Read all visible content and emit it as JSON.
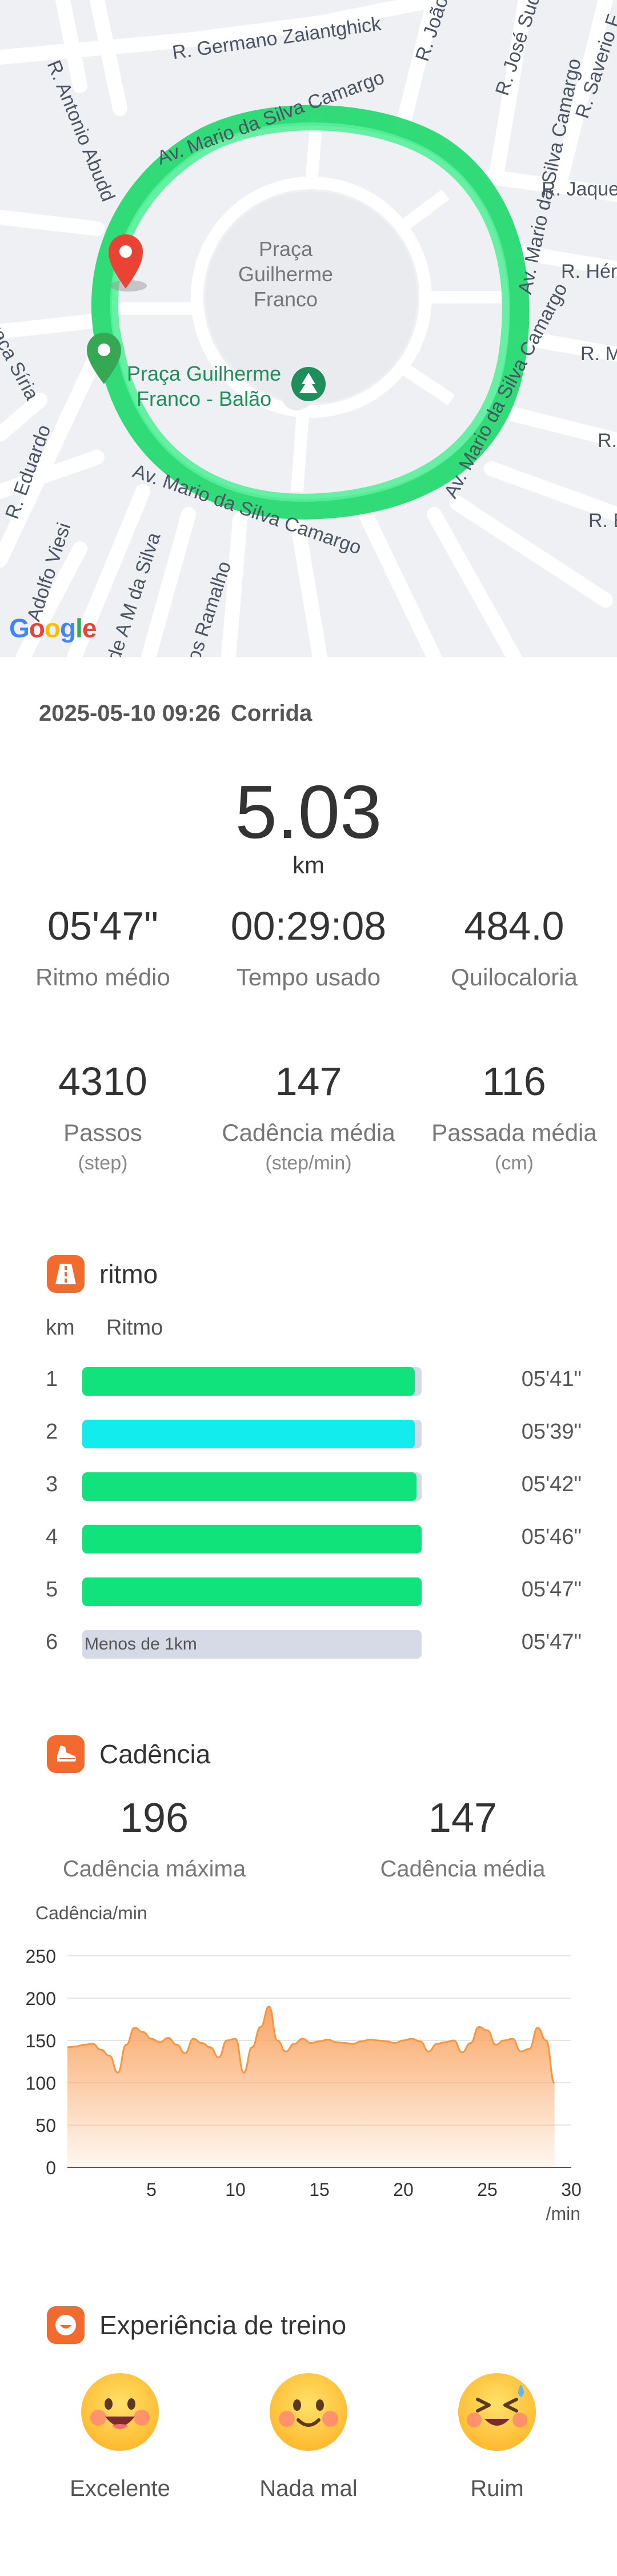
{
  "map": {
    "streets": [
      "R. Germano Zaiantghick",
      "R. Antonio Abudd",
      "R. João S",
      "R. José Sud",
      "R. Saverio F",
      "Av. Mario da Silva Camargo",
      "R. Jaque",
      "R. Hér",
      "R. M",
      "R. ",
      "R. E",
      "Praça Síria",
      "R. Eduardo",
      "Adolfo Viesi",
      "de A M da Silva",
      "os Ramalho",
      "Av. Mario da Silva Camargo",
      "Av. Mario da Silva Camargo",
      "Av. Mario da Silva Camargo"
    ],
    "park_label": "Praça Guilherme Franco",
    "park_label_lines": [
      "Praça",
      "Guilherme",
      "Franco"
    ],
    "poi_label_lines": [
      "Praça Guilherme",
      "Franco - Balão"
    ],
    "google": [
      "G",
      "o",
      "o",
      "g",
      "l",
      "e"
    ]
  },
  "header": {
    "datetime": "2025-05-10 09:26",
    "activity": "Corrida"
  },
  "summary": {
    "distance": "5.03",
    "distance_unit": "km",
    "stats": [
      {
        "value": "05'47\"",
        "label": "Ritmo médio",
        "unit": ""
      },
      {
        "value": "00:29:08",
        "label": "Tempo usado",
        "unit": ""
      },
      {
        "value": "484.0",
        "label": "Quilocaloria",
        "unit": ""
      }
    ],
    "stats2": [
      {
        "value": "4310",
        "label": "Passos",
        "unit": "(step)"
      },
      {
        "value": "147",
        "label": "Cadência média",
        "unit": "(step/min)"
      },
      {
        "value": "116",
        "label": "Passada média",
        "unit": "(cm)"
      }
    ]
  },
  "pace": {
    "title": "ritmo",
    "col_km": "km",
    "col_pace": "Ritmo",
    "rows": [
      {
        "km": "1",
        "time": "05'41\"",
        "fraction": 0.98,
        "color": "#10e37b",
        "note": ""
      },
      {
        "km": "2",
        "time": "05'39\"",
        "fraction": 0.98,
        "color": "#13ecec",
        "note": ""
      },
      {
        "km": "3",
        "time": "05'42\"",
        "fraction": 0.985,
        "color": "#10e37b",
        "note": ""
      },
      {
        "km": "4",
        "time": "05'46\"",
        "fraction": 1.0,
        "color": "#10e37b",
        "note": ""
      },
      {
        "km": "5",
        "time": "05'47\"",
        "fraction": 1.0,
        "color": "#10e37b",
        "note": ""
      },
      {
        "km": "6",
        "time": "05'47\"",
        "fraction": 0.0,
        "color": "#d6d9e6",
        "note": "Menos de 1km"
      }
    ]
  },
  "cadence": {
    "title": "Cadência",
    "max_value": "196",
    "max_label": "Cadência máxima",
    "avg_value": "147",
    "avg_label": "Cadência média"
  },
  "chart_data": {
    "type": "area",
    "ylabel": "Cadência/min",
    "xlabel": "/min",
    "ylim": [
      0,
      250
    ],
    "xlim": [
      0,
      30
    ],
    "yticks": [
      "0",
      "50",
      "100",
      "150",
      "200",
      "250"
    ],
    "xticks": [
      "5",
      "10",
      "15",
      "20",
      "25",
      "30"
    ],
    "grid": true,
    "color": "#f9a15c",
    "x": [
      0,
      0.5,
      1,
      1.5,
      2,
      2.5,
      3,
      3.5,
      4,
      4.5,
      5,
      5.5,
      6,
      6.5,
      7,
      7.5,
      8,
      8.5,
      9,
      9.5,
      10,
      10.5,
      11,
      11.5,
      12,
      12.5,
      13,
      13.5,
      14,
      14.5,
      15,
      15.5,
      16,
      16.5,
      17,
      17.5,
      18,
      18.5,
      19,
      19.5,
      20,
      20.5,
      21,
      21.5,
      22,
      22.5,
      23,
      23.5,
      24,
      24.5,
      25,
      25.5,
      26,
      26.5,
      27,
      27.5,
      28,
      28.5,
      29
    ],
    "values": [
      142,
      143,
      145,
      146,
      139,
      132,
      112,
      145,
      165,
      160,
      152,
      148,
      153,
      145,
      135,
      152,
      147,
      142,
      130,
      150,
      152,
      112,
      142,
      166,
      190,
      150,
      137,
      146,
      152,
      147,
      149,
      151,
      148,
      147,
      146,
      149,
      151,
      150,
      149,
      147,
      150,
      152,
      149,
      137,
      146,
      148,
      150,
      136,
      147,
      166,
      162,
      145,
      150,
      152,
      137,
      140,
      165,
      150,
      100
    ]
  },
  "experience": {
    "title": "Experiência de treino",
    "options": [
      {
        "label": "Excelente",
        "icon": "excellent-face-icon"
      },
      {
        "label": "Nada mal",
        "icon": "not-bad-face-icon"
      },
      {
        "label": "Ruim",
        "icon": "bad-face-icon"
      }
    ]
  }
}
